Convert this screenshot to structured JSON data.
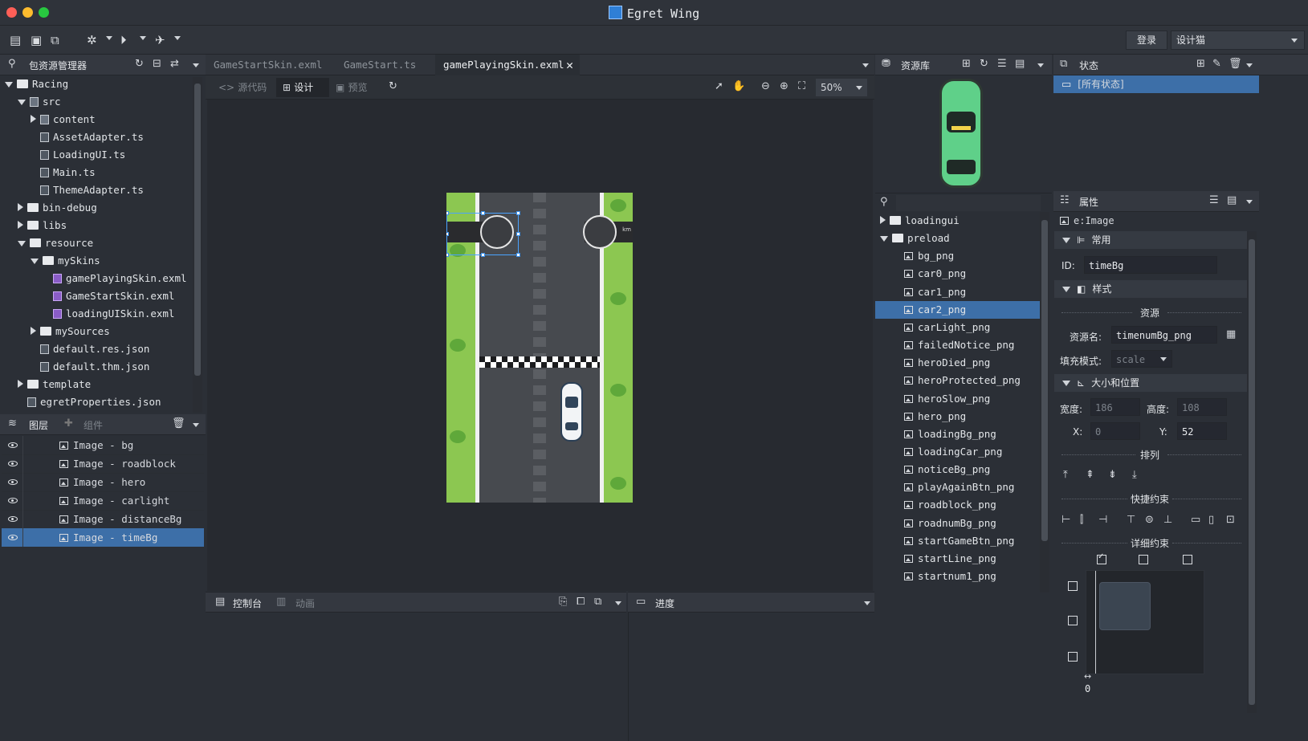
{
  "window": {
    "title": "Egret Wing"
  },
  "toolbar": {
    "login": "登录",
    "user": "设计猫"
  },
  "explorer": {
    "title": "包资源管理器",
    "tree": [
      {
        "label": "Racing",
        "depth": 0,
        "kind": "project",
        "expanded": true
      },
      {
        "label": "src",
        "depth": 1,
        "kind": "pkg",
        "expanded": true
      },
      {
        "label": "content",
        "depth": 2,
        "kind": "pkg",
        "expanded": false
      },
      {
        "label": "AssetAdapter.ts",
        "depth": 2,
        "kind": "file"
      },
      {
        "label": "LoadingUI.ts",
        "depth": 2,
        "kind": "file"
      },
      {
        "label": "Main.ts",
        "depth": 2,
        "kind": "file"
      },
      {
        "label": "ThemeAdapter.ts",
        "depth": 2,
        "kind": "file"
      },
      {
        "label": "bin-debug",
        "depth": 1,
        "kind": "folder",
        "expanded": false
      },
      {
        "label": "libs",
        "depth": 1,
        "kind": "folder",
        "expanded": false
      },
      {
        "label": "resource",
        "depth": 1,
        "kind": "folder",
        "expanded": true
      },
      {
        "label": "mySkins",
        "depth": 2,
        "kind": "folder",
        "expanded": true
      },
      {
        "label": "gamePlayingSkin.exml",
        "depth": 3,
        "kind": "exml"
      },
      {
        "label": "GameStartSkin.exml",
        "depth": 3,
        "kind": "exml"
      },
      {
        "label": "loadingUISkin.exml",
        "depth": 3,
        "kind": "exml"
      },
      {
        "label": "mySources",
        "depth": 2,
        "kind": "folder",
        "expanded": false
      },
      {
        "label": "default.res.json",
        "depth": 2,
        "kind": "file"
      },
      {
        "label": "default.thm.json",
        "depth": 2,
        "kind": "file"
      },
      {
        "label": "template",
        "depth": 1,
        "kind": "folder",
        "expanded": false
      },
      {
        "label": "egretProperties.json",
        "depth": 1,
        "kind": "file"
      }
    ]
  },
  "layers": {
    "tab_layers": "图层",
    "tab_components": "组件",
    "items": [
      {
        "label": "Image - bg",
        "selected": false
      },
      {
        "label": "Image - roadblock",
        "selected": false
      },
      {
        "label": "Image - hero",
        "selected": false
      },
      {
        "label": "Image - carlight",
        "selected": false
      },
      {
        "label": "Image - distanceBg",
        "selected": false
      },
      {
        "label": "Image - timeBg",
        "selected": true
      }
    ]
  },
  "editor": {
    "tabs": [
      {
        "label": "GameStartSkin.exml",
        "active": false
      },
      {
        "label": "GameStart.ts",
        "active": false
      },
      {
        "label": "gamePlayingSkin.exml",
        "active": true
      }
    ],
    "mode_source": "源代码",
    "mode_design": "设计",
    "mode_preview": "预览",
    "zoom": "50%",
    "km_label": "km"
  },
  "bottom": {
    "console": "控制台",
    "animation": "动画",
    "progress": "进度"
  },
  "resources": {
    "title": "资源库",
    "items": [
      {
        "label": "loadingui",
        "kind": "folder",
        "expanded": false
      },
      {
        "label": "preload",
        "kind": "folder",
        "expanded": true
      },
      {
        "label": "bg_png",
        "kind": "img"
      },
      {
        "label": "car0_png",
        "kind": "img"
      },
      {
        "label": "car1_png",
        "kind": "img"
      },
      {
        "label": "car2_png",
        "kind": "img",
        "selected": true
      },
      {
        "label": "carLight_png",
        "kind": "img"
      },
      {
        "label": "failedNotice_png",
        "kind": "img"
      },
      {
        "label": "heroDied_png",
        "kind": "img"
      },
      {
        "label": "heroProtected_png",
        "kind": "img"
      },
      {
        "label": "heroSlow_png",
        "kind": "img"
      },
      {
        "label": "hero_png",
        "kind": "img"
      },
      {
        "label": "loadingBg_png",
        "kind": "img"
      },
      {
        "label": "loadingCar_png",
        "kind": "img"
      },
      {
        "label": "noticeBg_png",
        "kind": "img"
      },
      {
        "label": "playAgainBtn_png",
        "kind": "img"
      },
      {
        "label": "roadblock_png",
        "kind": "img"
      },
      {
        "label": "roadnumBg_png",
        "kind": "img"
      },
      {
        "label": "startGameBtn_png",
        "kind": "img"
      },
      {
        "label": "startLine_png",
        "kind": "img"
      },
      {
        "label": "startnum1_png",
        "kind": "img"
      }
    ]
  },
  "states": {
    "title": "状态",
    "all_states": "[所有状态]"
  },
  "properties": {
    "title": "属性",
    "element": "e:Image",
    "common": "常用",
    "id_label": "ID:",
    "id_value": "timeBg",
    "style": "样式",
    "resource": "资源",
    "res_name_label": "资源名:",
    "res_name_value": "timenumBg_png",
    "fill_mode_label": "填充模式:",
    "fill_mode_value": "scale",
    "size_pos": "大小和位置",
    "width_label": "宽度:",
    "width_value": "186",
    "height_label": "高度:",
    "height_value": "108",
    "x_label": "X:",
    "x_value": "0",
    "y_label": "Y:",
    "y_value": "52",
    "arrange": "排列",
    "quick_constraint": "快捷约束",
    "detail_constraint": "详细约束",
    "constraint_value": "0"
  },
  "colors": {
    "accent": "#3d6fa8",
    "grass": "#8cc751",
    "road": "#474a4f"
  }
}
